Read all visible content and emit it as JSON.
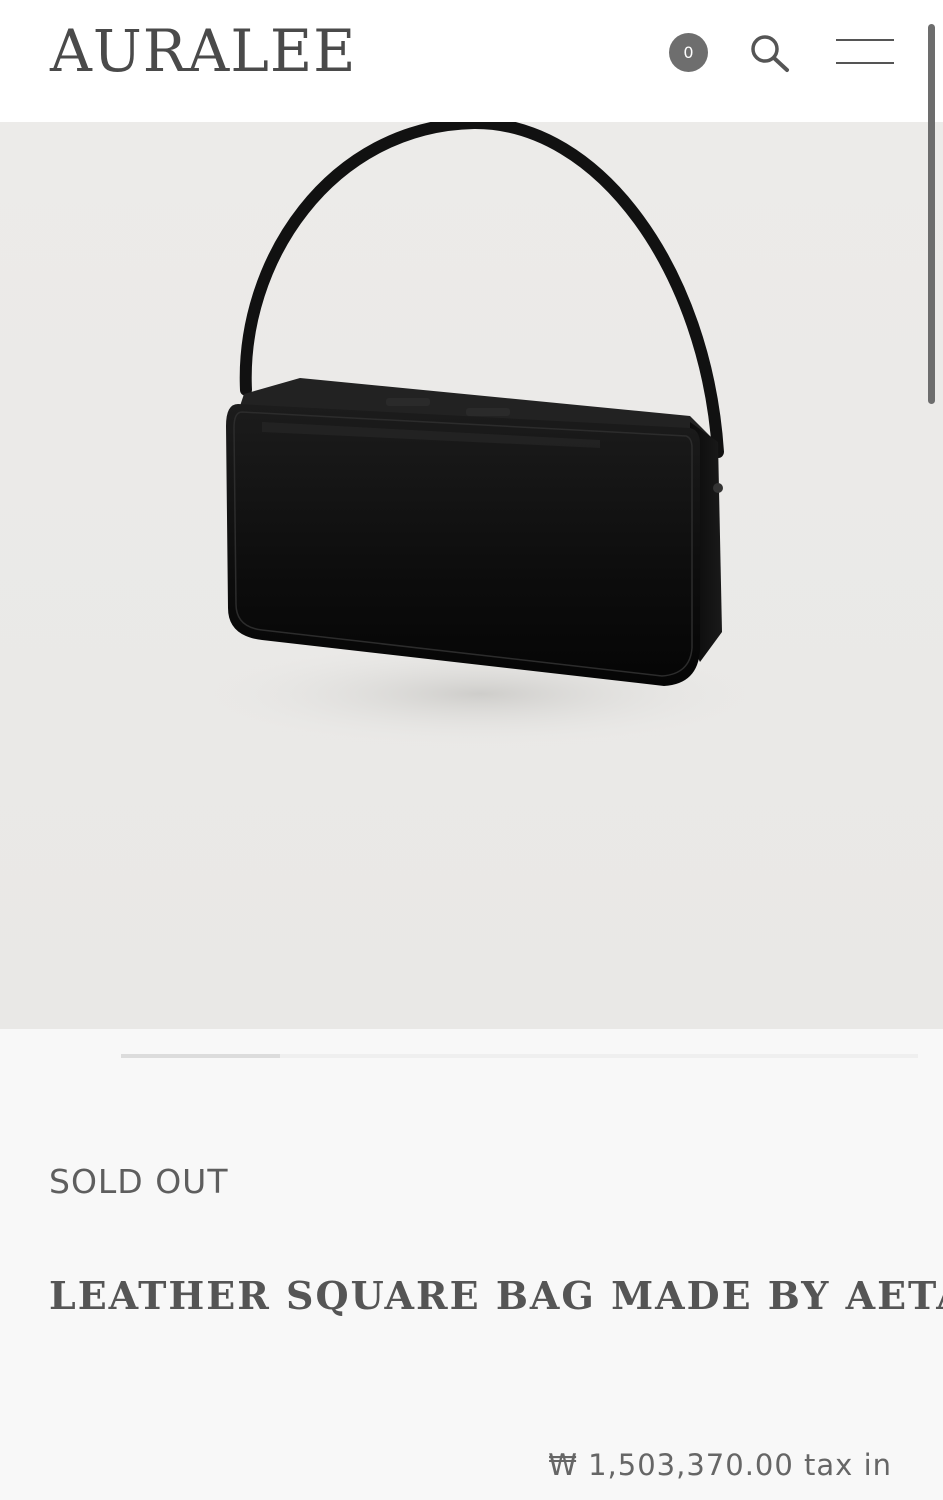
{
  "header": {
    "logo": "AURALEE",
    "cart_count": "0",
    "search_icon": "search-icon",
    "menu_icon": "hamburger-menu-icon"
  },
  "hero": {
    "image": "black-leather-square-bag-photo",
    "slide": "1 of 5"
  },
  "product": {
    "status": "SOLD OUT",
    "name": "LEATHER SQUARE BAG MADE BY AETA",
    "price": "₩ 1,503,370.00 tax in"
  },
  "colors": {
    "header_bg": "#ffffff",
    "page_bg": "#f8f8f8",
    "photo_bg": "#eae9e7",
    "badge": "#6e6e6e",
    "text": "#555555"
  }
}
